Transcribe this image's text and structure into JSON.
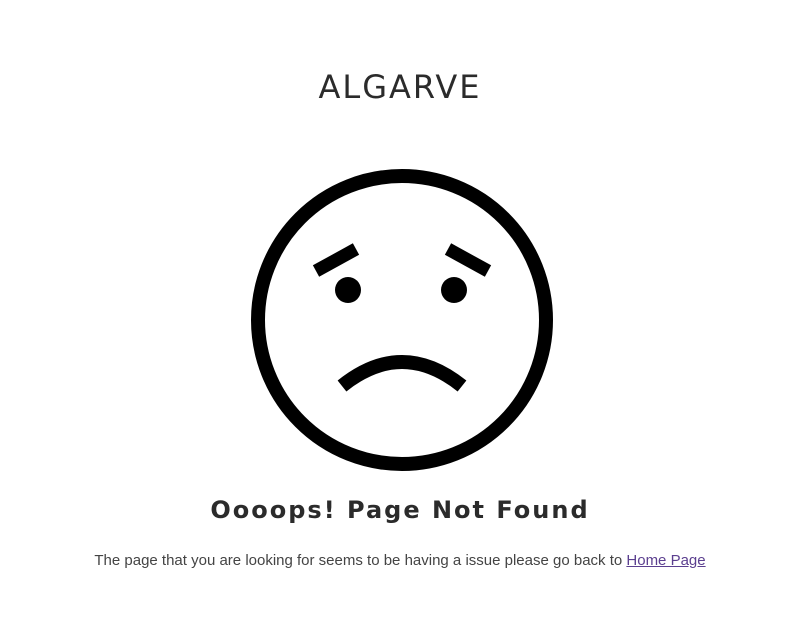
{
  "header": {
    "brand": "ALGARVE"
  },
  "illustration": {
    "icon": "sad-face-icon",
    "stroke_color": "#000000"
  },
  "main": {
    "heading": "Oooops! Page Not Found",
    "message": "The page that you are looking for seems to be having a issue please go back to",
    "home_link_label": "Home Page"
  },
  "colors": {
    "background": "#ffffff",
    "text": "#2b2b2b",
    "link": "#5b3f8f"
  }
}
